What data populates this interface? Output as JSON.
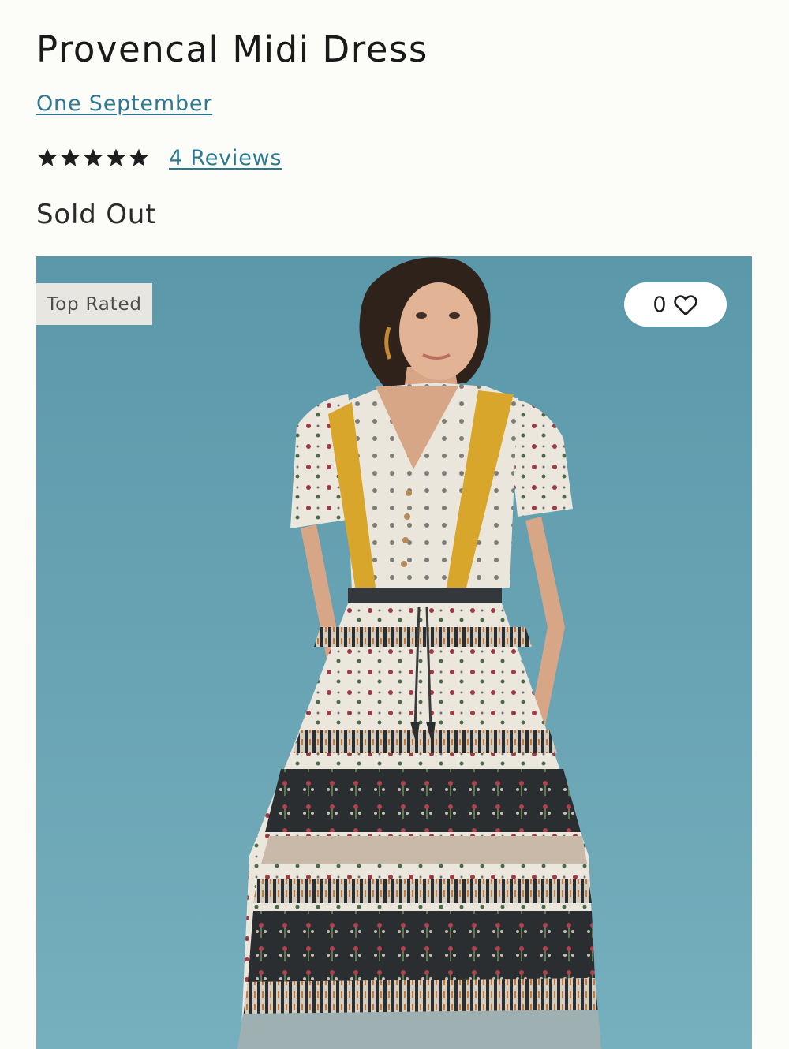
{
  "product": {
    "title": "Provencal Midi Dress",
    "brand": "One September",
    "rating": 5,
    "rating_max": 5,
    "reviews_label": "4 Reviews",
    "stock_status": "Sold Out"
  },
  "image": {
    "badge": "Top Rated",
    "wishlist_count": "0",
    "wishlist_icon": "heart-outline-icon",
    "background_color": "#67a2b2"
  },
  "colors": {
    "link": "#2d7891",
    "text": "#1e1e1e",
    "page_background": "#fcfcf8"
  }
}
